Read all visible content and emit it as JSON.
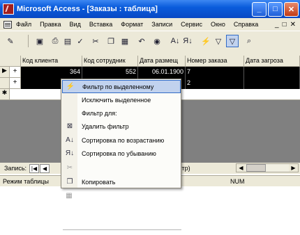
{
  "window": {
    "title": "Microsoft Access - [Заказы : таблица]",
    "controls": {
      "minimize": "_",
      "maximize": "□",
      "close": "✕"
    }
  },
  "menubar": {
    "items": [
      "Файл",
      "Правка",
      "Вид",
      "Вставка",
      "Формат",
      "Записи",
      "Сервис",
      "Окно",
      "Справка"
    ],
    "mdi_controls": [
      "_",
      "□",
      "✕"
    ]
  },
  "toolbar": {
    "icons": [
      "design-view",
      "save",
      "print",
      "print-preview",
      "spelling",
      "cut",
      "copy",
      "paste",
      "undo",
      "hyperlink",
      "sort-ascending",
      "sort-descending",
      "filter-by-selection",
      "filter-by-form",
      "apply-filter",
      "find"
    ]
  },
  "table": {
    "columns": [
      "Код клиента",
      "Код сотрудник",
      "Дата размещ",
      "Номер заказа",
      "Дата загроза"
    ],
    "rows": [
      {
        "selector": "▶",
        "expand": "+",
        "cells": [
          "364",
          "552",
          "06.01.1900",
          "7",
          ""
        ]
      },
      {
        "selector": "",
        "expand": "+",
        "cells": [
          "",
          "",
          "",
          "2",
          ""
        ]
      }
    ],
    "new_row_marker": "✱"
  },
  "record_nav": {
    "label": "Запись:",
    "first": "|◀",
    "prev": "◀",
    "partial_text": ".тр)",
    "scroll_left": "◀",
    "scroll_right": "▶"
  },
  "statusbar": {
    "mode": "Режим таблицы",
    "indicator": "NUM"
  },
  "context_menu": {
    "items": [
      {
        "icon": "filter-by-selection",
        "label": "Фильтр по выделенному",
        "highlighted": true,
        "disabled": false
      },
      {
        "icon": "",
        "label": "Исключить выделенное",
        "highlighted": false,
        "disabled": false
      },
      {
        "icon": "",
        "label": "Фильтр для:",
        "highlighted": false,
        "disabled": false
      },
      {
        "icon": "remove-filter",
        "label": "Удалить фильтр",
        "highlighted": false,
        "disabled": false
      },
      {
        "icon": "sort-ascending",
        "label": "Сортировка по возрастанию",
        "highlighted": false,
        "disabled": false
      },
      {
        "icon": "sort-descending",
        "label": "Сортировка по убыванию",
        "highlighted": false,
        "disabled": false
      },
      {
        "icon": "cut",
        "label": "",
        "highlighted": false,
        "disabled": true
      },
      {
        "icon": "copy",
        "label": "Копировать",
        "highlighted": false,
        "disabled": false
      },
      {
        "icon": "paste",
        "label": "",
        "highlighted": false,
        "disabled": true
      }
    ]
  }
}
